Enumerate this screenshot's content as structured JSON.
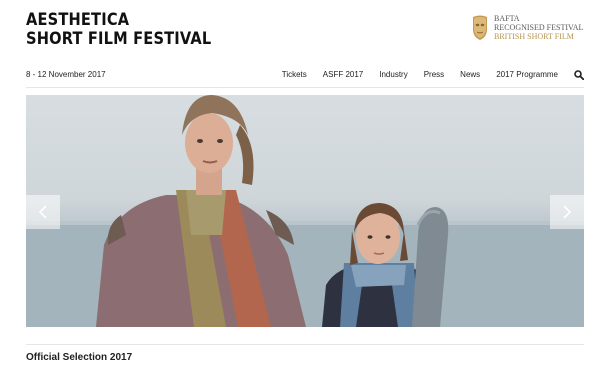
{
  "site": {
    "logo_line1": "AESTHETICA",
    "logo_line2": "SHORT FILM FESTIVAL"
  },
  "bafta": {
    "line1": "BAFTA",
    "line2": "RECOGNISED FESTIVAL",
    "line3": "BRITISH SHORT FILM",
    "icon": "bafta-mask-icon"
  },
  "nav": {
    "dates": "8 - 12 November 2017",
    "items": [
      "Tickets",
      "ASFF 2017",
      "Industry",
      "Press",
      "News",
      "2017 Programme"
    ],
    "search_icon": "search-icon"
  },
  "slider": {
    "prev_icon": "chevron-left-icon",
    "next_icon": "chevron-right-icon"
  },
  "section": {
    "title": "Official Selection 2017"
  },
  "colors": {
    "bafta_gold": "#b8944f",
    "text": "#1a1a1a",
    "divider": "#e6e6e6"
  }
}
